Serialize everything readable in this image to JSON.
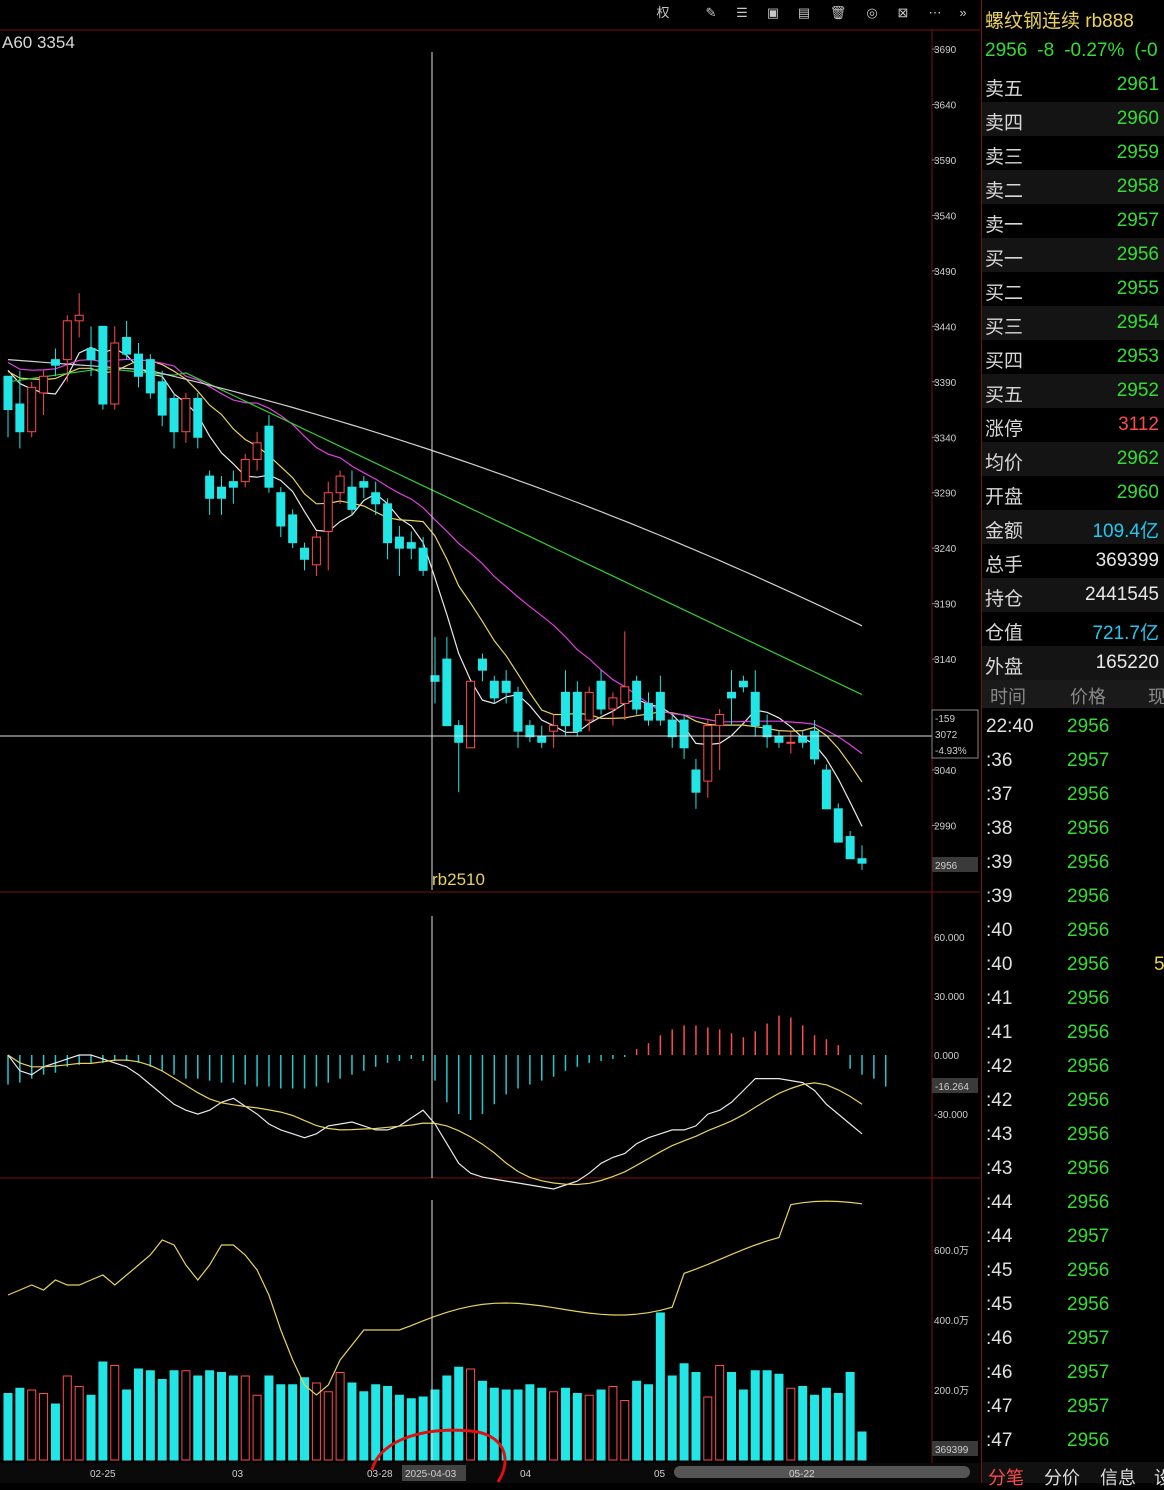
{
  "colors": {
    "up": "#ff4b4b",
    "down": "#22e6e6",
    "green": "#33dd33",
    "red": "#ff4b4b",
    "cyan": "#22c8f0",
    "yellow": "#e8d25a",
    "white": "#e8e8e8",
    "magenta": "#e040e0",
    "ma_green": "#33cc33",
    "grid": "#7a1010"
  },
  "toolbar": {
    "icons": [
      "adjust-rights-icon",
      "draw-icon",
      "settings-sliders-icon",
      "save-layout-icon",
      "window-icon",
      "delete-icon",
      "target-icon",
      "fullscreen-icon",
      "more-icon",
      "collapse-panel-icon"
    ],
    "quan_label": "权"
  },
  "main": {
    "ma_label": "A60 3354",
    "contract_label": "rb2510",
    "crosshair": {
      "diff": "-159",
      "price": "3072",
      "pct": "-4.93%"
    },
    "last_price_tag": "2956",
    "y_ticks": [
      "3690",
      "3640",
      "3590",
      "3540",
      "3490",
      "3440",
      "3390",
      "3340",
      "3290",
      "3240",
      "3190",
      "3140",
      "3040",
      "2990"
    ]
  },
  "macd": {
    "y_ticks": [
      "60.000",
      "30.000",
      "0.000",
      "-30.000"
    ],
    "tag": "-16.264"
  },
  "volume": {
    "y_ticks": [
      "600.0万",
      "400.0万",
      "200.0万"
    ],
    "tag": "369399"
  },
  "x_axis": {
    "labels": [
      "02-25",
      "03",
      "03-28",
      "2025-04-03",
      "04",
      "05",
      "05-22"
    ]
  },
  "chart_data": {
    "type": "candlestick",
    "title": "",
    "ylim": [
      2930,
      3700
    ],
    "candles": [
      [
        3395,
        3395,
        3340,
        3365
      ],
      [
        3370,
        3400,
        3330,
        3345
      ],
      [
        3345,
        3390,
        3340,
        3385
      ],
      [
        3380,
        3400,
        3360,
        3395
      ],
      [
        3410,
        3420,
        3395,
        3405
      ],
      [
        3410,
        3450,
        3390,
        3445
      ],
      [
        3445,
        3470,
        3430,
        3450
      ],
      [
        3420,
        3440,
        3395,
        3410
      ],
      [
        3440,
        3440,
        3365,
        3370
      ],
      [
        3370,
        3440,
        3365,
        3425
      ],
      [
        3430,
        3445,
        3410,
        3415
      ],
      [
        3415,
        3425,
        3385,
        3395
      ],
      [
        3410,
        3415,
        3375,
        3380
      ],
      [
        3390,
        3400,
        3350,
        3360
      ],
      [
        3375,
        3380,
        3330,
        3345
      ],
      [
        3345,
        3380,
        3335,
        3375
      ],
      [
        3375,
        3380,
        3330,
        3340
      ],
      [
        3305,
        3310,
        3270,
        3285
      ],
      [
        3295,
        3305,
        3270,
        3285
      ],
      [
        3300,
        3310,
        3280,
        3295
      ],
      [
        3300,
        3325,
        3295,
        3320
      ],
      [
        3320,
        3345,
        3310,
        3335
      ],
      [
        3350,
        3360,
        3290,
        3295
      ],
      [
        3290,
        3295,
        3250,
        3260
      ],
      [
        3270,
        3275,
        3240,
        3245
      ],
      [
        3240,
        3245,
        3220,
        3230
      ],
      [
        3225,
        3255,
        3215,
        3250
      ],
      [
        3255,
        3300,
        3220,
        3290
      ],
      [
        3290,
        3310,
        3280,
        3305
      ],
      [
        3295,
        3310,
        3270,
        3275
      ],
      [
        3300,
        3305,
        3285,
        3295
      ],
      [
        3290,
        3300,
        3270,
        3280
      ],
      [
        3280,
        3285,
        3230,
        3245
      ],
      [
        3250,
        3260,
        3215,
        3240
      ],
      [
        3245,
        3255,
        3230,
        3240
      ],
      [
        3240,
        3250,
        3215,
        3220
      ],
      [
        3125,
        3160,
        3100,
        3120
      ],
      [
        3140,
        3160,
        3080,
        3080
      ],
      [
        3080,
        3085,
        3020,
        3065
      ],
      [
        3060,
        3120,
        3060,
        3120
      ],
      [
        3140,
        3145,
        3120,
        3130
      ],
      [
        3120,
        3125,
        3100,
        3105
      ],
      [
        3120,
        3130,
        3100,
        3110
      ],
      [
        3110,
        3115,
        3060,
        3075
      ],
      [
        3080,
        3085,
        3065,
        3070
      ],
      [
        3070,
        3080,
        3060,
        3065
      ],
      [
        3075,
        3090,
        3060,
        3080
      ],
      [
        3110,
        3130,
        3070,
        3080
      ],
      [
        3110,
        3120,
        3070,
        3075
      ],
      [
        3085,
        3115,
        3075,
        3110
      ],
      [
        3120,
        3130,
        3090,
        3095
      ],
      [
        3095,
        3110,
        3080,
        3105
      ],
      [
        3100,
        3165,
        3085,
        3115
      ],
      [
        3120,
        3125,
        3090,
        3095
      ],
      [
        3100,
        3110,
        3080,
        3085
      ],
      [
        3110,
        3125,
        3080,
        3085
      ],
      [
        3085,
        3090,
        3060,
        3070
      ],
      [
        3085,
        3090,
        3050,
        3060
      ],
      [
        3040,
        3050,
        3005,
        3020
      ],
      [
        3030,
        3085,
        3015,
        3080
      ],
      [
        3080,
        3095,
        3040,
        3090
      ],
      [
        3110,
        3130,
        3080,
        3105
      ],
      [
        3120,
        3125,
        3110,
        3115
      ],
      [
        3110,
        3130,
        3070,
        3080
      ],
      [
        3080,
        3090,
        3060,
        3070
      ],
      [
        3070,
        3075,
        3060,
        3065
      ],
      [
        3065,
        3075,
        3055,
        3065
      ],
      [
        3070,
        3075,
        3060,
        3065
      ],
      [
        3075,
        3085,
        3045,
        3050
      ],
      [
        3040,
        3045,
        3005,
        3005
      ],
      [
        3005,
        3010,
        2975,
        2975
      ],
      [
        2980,
        2985,
        2960,
        2960
      ],
      [
        2960,
        2972,
        2950,
        2956
      ]
    ],
    "macd_hist": [
      -15,
      -14,
      -12,
      -10,
      -9,
      -6,
      -5,
      -4,
      -4,
      -3,
      -3,
      -4,
      -6,
      -8,
      -10,
      -12,
      -12,
      -13,
      -14,
      -14,
      -15,
      -16,
      -16,
      -17,
      -17,
      -17,
      -16,
      -14,
      -12,
      -10,
      -8,
      -6,
      -4,
      -3,
      -2,
      -3,
      -13,
      -24,
      -30,
      -33,
      -30,
      -25,
      -20,
      -17,
      -15,
      -13,
      -11,
      -8,
      -6,
      -4,
      -3,
      -2,
      -1,
      3,
      6,
      10,
      13,
      15,
      15,
      14,
      13,
      11,
      9,
      12,
      16,
      20,
      19,
      15,
      10,
      8,
      5,
      -7,
      -10,
      -12,
      -16
    ],
    "volume": [
      190,
      205,
      200,
      190,
      160,
      240,
      210,
      185,
      280,
      270,
      200,
      260,
      255,
      230,
      255,
      255,
      240,
      255,
      250,
      240,
      240,
      185,
      240,
      215,
      215,
      235,
      220,
      195,
      250,
      220,
      195,
      215,
      210,
      185,
      175,
      180,
      200,
      240,
      265,
      260,
      225,
      205,
      200,
      200,
      215,
      205,
      195,
      205,
      190,
      185,
      200,
      210,
      170,
      225,
      215,
      420,
      240,
      275,
      250,
      180,
      270,
      250,
      200,
      255,
      255,
      245,
      205,
      210,
      185,
      205,
      190,
      250,
      80
    ]
  }
}
